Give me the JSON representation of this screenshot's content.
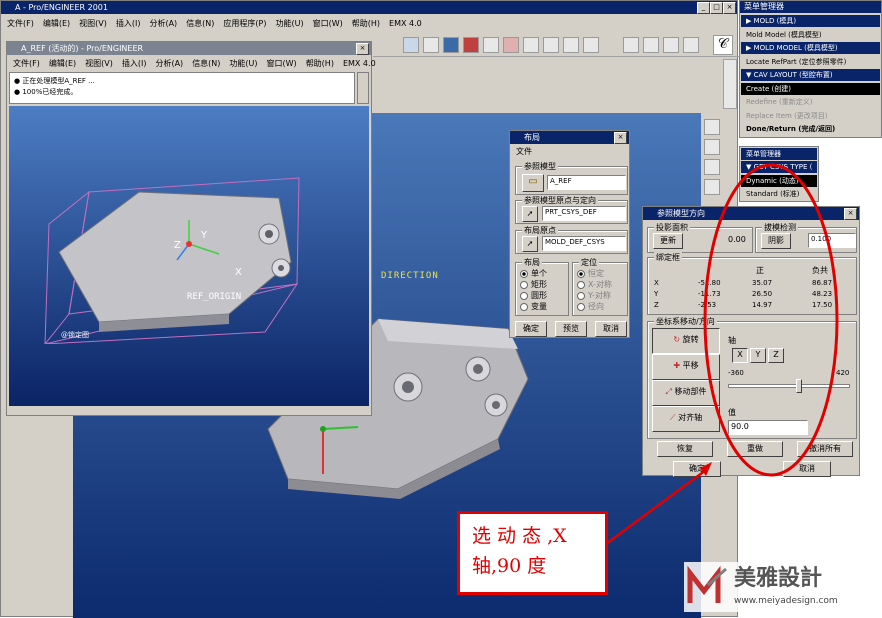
{
  "main_window": {
    "title": "A - Pro/ENGINEER 2001",
    "menu": [
      "文件(F)",
      "编辑(E)",
      "视图(V)",
      "插入(I)",
      "分析(A)",
      "信息(N)",
      "应用程序(P)",
      "功能(U)",
      "窗口(W)",
      "帮助(H)",
      "EMX 4.0"
    ]
  },
  "ref_window": {
    "title": "A_REF (活动的) - Pro/ENGINEER",
    "menu": [
      "文件(F)",
      "编辑(E)",
      "视图(V)",
      "插入(I)",
      "分析(A)",
      "信息(N)",
      "功能(U)",
      "窗口(W)",
      "帮助(H)",
      "EMX 4.0"
    ],
    "messages": [
      "● 正在处理模型A_REF ...",
      "● 100%已经完成。"
    ],
    "model_label_ref": "REF_ORIGIN",
    "axis_z": "Z",
    "axis_y": "Y",
    "axis_x": "X",
    "corner_label": "@锁定图"
  },
  "direction_text": "DIRECTION",
  "menu_manager": {
    "title": "菜单管理器",
    "items": [
      {
        "label": "▶ MOLD (模具)",
        "style": "blue"
      },
      {
        "label": "Mold Model (模具模型)",
        "style": "normal"
      },
      {
        "label": "▶ MOLD MODEL (模具模型)",
        "style": "blue"
      },
      {
        "label": "Locate RefPart (定位参照零件)",
        "style": "normal"
      },
      {
        "label": "▼ CAV LAYOUT (型腔布置)",
        "style": "blue"
      },
      {
        "label": "Create (创建)",
        "style": "black"
      },
      {
        "label": "Redefine (重新定义)",
        "style": "gray"
      },
      {
        "label": "Replace Item (更改项目)",
        "style": "gray"
      },
      {
        "label": "Done/Return (完成/返回)",
        "style": "bold"
      }
    ]
  },
  "getcsys_menu": {
    "title": "菜单管理器",
    "header": "▼ GET CSYS TYPE (",
    "items": [
      "Dynamic (动态)",
      "Standard (标准)"
    ]
  },
  "layout_dialog": {
    "title": "布局",
    "file_label": "文件",
    "ref_model_group": "参照模型",
    "ref_model_value": "A_REF",
    "ref_origin_group": "参照模型原点与定向",
    "ref_origin_value": "PRT_CSYS_DEF",
    "layout_origin_group": "布局原点",
    "layout_origin_value": "MOLD_DEF_CSYS",
    "layout_group": "布局",
    "layout_options": [
      "单个",
      "矩形",
      "圆形",
      "变量"
    ],
    "orient_group": "定位",
    "orient_options": [
      "恒定",
      "X-对称",
      "Y-对称",
      "径向"
    ],
    "buttons": [
      "确定",
      "预览",
      "取消"
    ]
  },
  "orient_dialog": {
    "title": "参照模型方向",
    "projection_group": "投影面积",
    "projection_btn": "更新",
    "projection_value": "0.00",
    "draft_group": "拔模检测",
    "draft_btn": "阴影",
    "draft_value": "0.100",
    "bbox_group": "绑定框",
    "bbox_headers": [
      "正",
      "负共"
    ],
    "bbox_rows": [
      {
        "axis": "X",
        "a": "-51.80",
        "b": "35.07",
        "c": "86.87"
      },
      {
        "axis": "Y",
        "a": "-11.73",
        "b": "26.50",
        "c": "48.23"
      },
      {
        "axis": "Z",
        "a": "-2.53",
        "b": "14.97",
        "c": "17.50"
      }
    ],
    "csys_group": "坐标系移动/方向",
    "tools": [
      "旋转",
      "平移",
      "移动部件",
      "对齐轴"
    ],
    "axis_label": "轴",
    "axis_buttons": [
      "X",
      "Y",
      "Z"
    ],
    "slider_min": "-360",
    "slider_max": "420",
    "value_label": "值",
    "value": "90.0",
    "bottom_buttons": [
      "恢复",
      "重做",
      "撤消所有"
    ],
    "ok": "确定",
    "cancel": "取消"
  },
  "callout": {
    "line1": "选 动 态 ,X",
    "line2": "轴,90 度"
  },
  "watermark": {
    "brand": "美雅設計",
    "url": "www.meiyadesign.com"
  },
  "colors": {
    "title_active": "#0a246a",
    "viewport_top": "#4a78b8",
    "viewport_bottom": "#0c2a6e",
    "callout_red": "#e00000"
  }
}
